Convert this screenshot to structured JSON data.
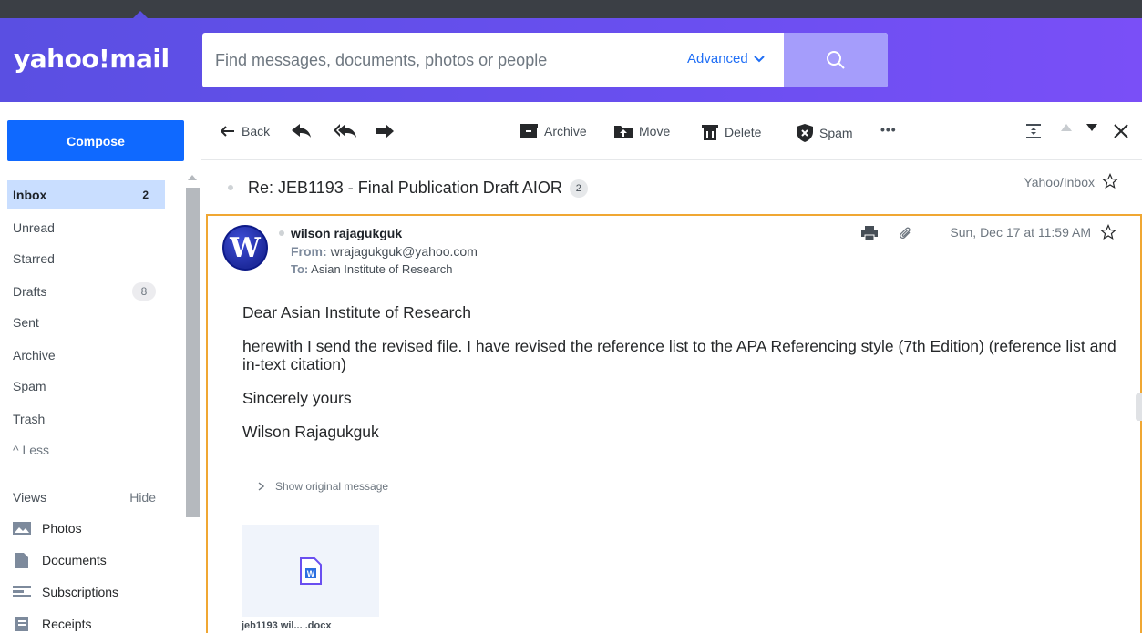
{
  "app": {
    "logo": "yahoo!mail"
  },
  "search": {
    "placeholder": "Find messages, documents, photos or people",
    "advanced_label": "Advanced"
  },
  "sidebar": {
    "compose_label": "Compose",
    "folders": [
      {
        "label": "Inbox",
        "count": "2",
        "active": true
      },
      {
        "label": "Unread"
      },
      {
        "label": "Starred"
      },
      {
        "label": "Drafts",
        "badge": "8"
      },
      {
        "label": "Sent"
      },
      {
        "label": "Archive"
      },
      {
        "label": "Spam"
      },
      {
        "label": "Trash"
      },
      {
        "label": "^ Less"
      }
    ],
    "views_label": "Views",
    "hide_label": "Hide",
    "views": [
      {
        "label": "Photos",
        "icon": "photos-icon"
      },
      {
        "label": "Documents",
        "icon": "documents-icon"
      },
      {
        "label": "Subscriptions",
        "icon": "subscriptions-icon"
      },
      {
        "label": "Receipts",
        "icon": "receipts-icon"
      }
    ]
  },
  "toolbar": {
    "back_label": "Back",
    "archive_label": "Archive",
    "move_label": "Move",
    "delete_label": "Delete",
    "spam_label": "Spam",
    "more_label": "•••"
  },
  "thread": {
    "subject": "Re: JEB1193 - Final Publication Draft AIOR",
    "count": "2",
    "folder_tag": "Yahoo/Inbox"
  },
  "message": {
    "avatar_letter": "W",
    "sender_name": "wilson rajagukguk",
    "from_label": "From:",
    "from_email": "wrajagukguk@yahoo.com",
    "to_label": "To:",
    "to_name": "Asian Institute of Research",
    "date": "Sun, Dec 17 at 11:59 AM",
    "body": [
      "Dear Asian Institute of Research",
      "herewith I send the revised file. I have  revised the reference list to the APA Referencing style (7th Edition) (reference list and in-text citation)",
      "Sincerely yours",
      "Wilson Rajagukguk"
    ],
    "show_original": "Show original message",
    "attachment_name": "jeb1193 wil... .docx"
  },
  "colors": {
    "header_start": "#5a4fe2",
    "header_end": "#7a4ff7",
    "compose": "#0f69ff",
    "active_folder": "#c9deff",
    "selected_border": "#f0a733",
    "word_icon": "#6a4ff0"
  }
}
